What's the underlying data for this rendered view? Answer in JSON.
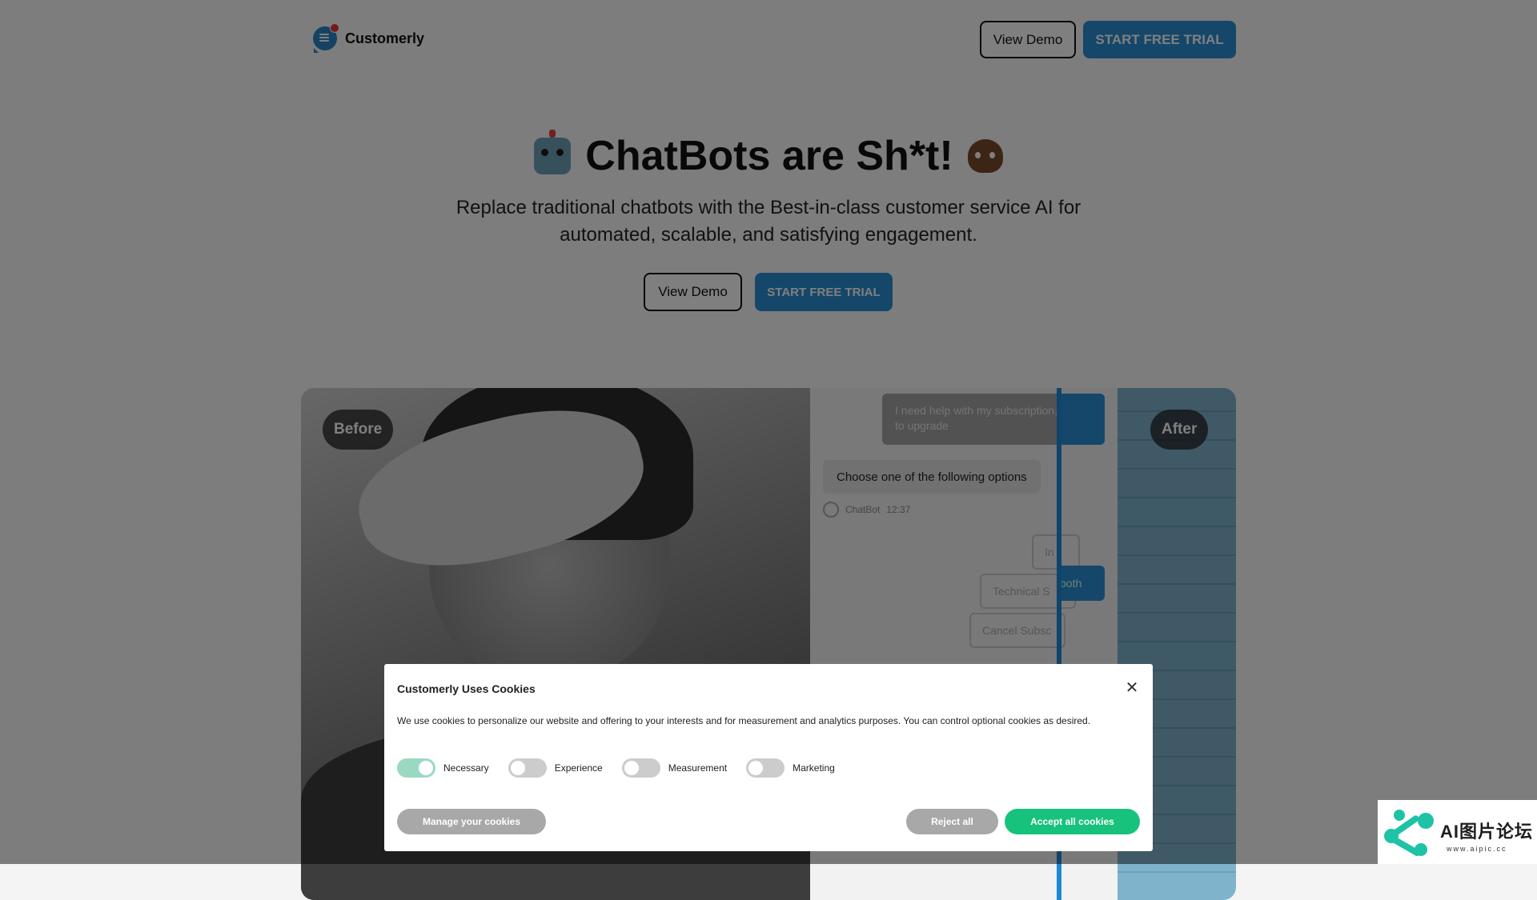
{
  "header": {
    "logo_text": "Customerly",
    "view_demo": "View Demo",
    "start_trial": "START FREE TRIAL"
  },
  "hero": {
    "title": "ChatBots are Sh*t!",
    "subtitle": "Replace traditional chatbots with the Best-in-class customer service AI for automated, scalable, and satisfying engagement.",
    "view_demo": "View Demo",
    "start_trial": "START FREE TRIAL"
  },
  "showcase": {
    "before_label": "Before",
    "after_label": "After",
    "user_message": "I need help with my subscription, I want to upgrade",
    "bot_message": "Choose one of the following options",
    "bot_name": "ChatBot",
    "bot_time": "12:37",
    "options": [
      "In",
      "Technical S",
      "Cancel Subsc"
    ],
    "option_fragment": "both"
  },
  "cookies": {
    "title": "Customerly Uses Cookies",
    "description": "We use cookies to personalize our website and offering to your interests and for measurement and analytics purposes. You can control optional cookies as desired.",
    "close_symbol": "✕",
    "toggles": [
      {
        "label": "Necessary",
        "on": true
      },
      {
        "label": "Experience",
        "on": false
      },
      {
        "label": "Measurement",
        "on": false
      },
      {
        "label": "Marketing",
        "on": false
      }
    ],
    "manage_label": "Manage your cookies",
    "reject_label": "Reject all",
    "accept_label": "Accept all cookies"
  },
  "colors": {
    "brand_blue": "#2a8fd4",
    "accept_green": "#17c27d",
    "toggle_on": "#9ad9c1"
  },
  "watermark": {
    "text": "AI图片论坛",
    "url": "www.aipic.cc"
  }
}
